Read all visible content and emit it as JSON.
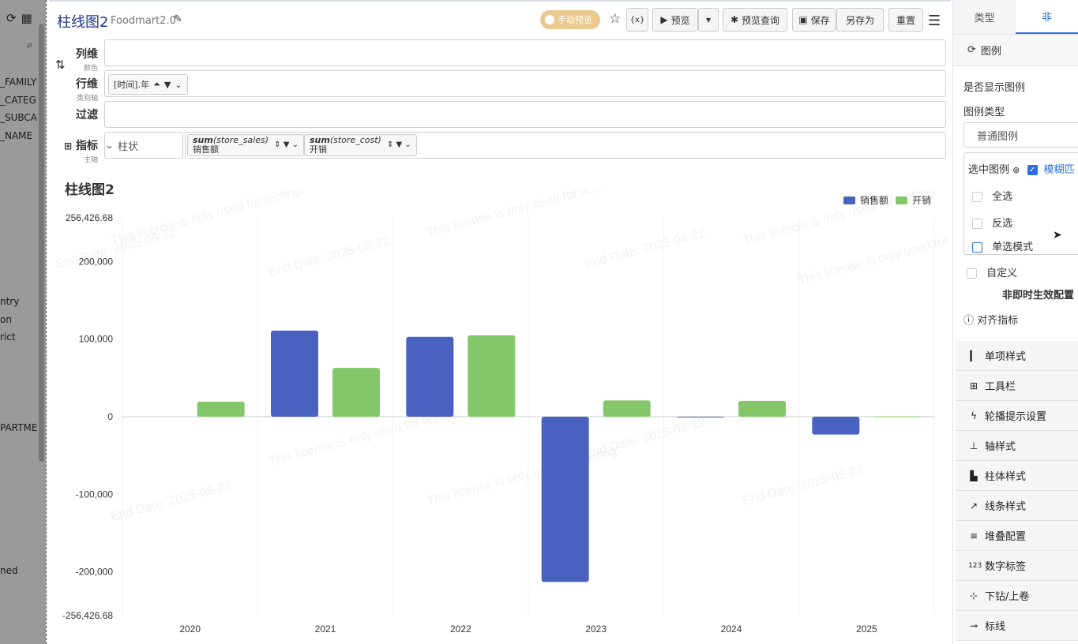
{
  "left_panel": {
    "fields": [
      "_FAMILY",
      "_CATEG",
      "_SUBCA",
      "_NAME",
      "ntry",
      "on",
      "rict",
      "PARTME",
      "ned"
    ]
  },
  "header": {
    "title": "柱线图2",
    "datasource": "Foodmart2.0",
    "manual_preview": "手动预览",
    "buttons": {
      "variable": "{x}",
      "preview": "预览",
      "preview_query": "预览查询",
      "save": "保存",
      "save_as": "另存为",
      "reset": "重置"
    }
  },
  "shelves": {
    "columns": {
      "label": "列维",
      "sub": "颜色"
    },
    "rows": {
      "label": "行维",
      "sub": "类别轴",
      "pill": "[时间].年"
    },
    "filter": {
      "label": "过滤"
    },
    "metrics": {
      "label": "指标",
      "sub": "主轴",
      "chart_type": "柱状",
      "pills": [
        {
          "func": "sum",
          "field": "(store_sales)",
          "name": "销售额"
        },
        {
          "func": "sum",
          "field": "(store_cost)",
          "name": "开销"
        }
      ]
    }
  },
  "chart_data": {
    "type": "bar",
    "title": "柱线图2",
    "categories": [
      "2020",
      "2021",
      "2022",
      "2023",
      "2024",
      "2025"
    ],
    "series": [
      {
        "name": "销售额",
        "color": "#4a62bf",
        "values": [
          0,
          111000,
          103000,
          -213000,
          -1000,
          -23000
        ]
      },
      {
        "name": "开销",
        "color": "#84c76a",
        "values": [
          19500,
          63000,
          105000,
          21000,
          20500,
          500
        ]
      }
    ],
    "y_ticks": [
      {
        "value": 256426.68,
        "label": "256,426.68"
      },
      {
        "value": 200000,
        "label": "200,000"
      },
      {
        "value": 100000,
        "label": "100,000"
      },
      {
        "value": 0,
        "label": "0"
      },
      {
        "value": -100000,
        "label": "-100,000"
      },
      {
        "value": -200000,
        "label": "-200,000"
      },
      {
        "value": -256426.68,
        "label": "-256,426.68"
      }
    ],
    "ylim": [
      -256426.68,
      256426.68
    ],
    "legend_position": "top-right",
    "watermark": [
      "This license is only used for testing!",
      "End Date: 2025-08-22"
    ]
  },
  "right_panel": {
    "tabs": [
      "类型",
      "非"
    ],
    "legend_section": "图例",
    "show_legend": "是否显示图例",
    "legend_type_label": "图例类型",
    "legend_type_value": "普通图例",
    "selected_legend": "选中图例",
    "fuzzy_match": "模糊匹",
    "select_all": "全选",
    "invert": "反选",
    "single_mode": "单选模式",
    "custom": "自定义",
    "non_instant": "非即时生效配置",
    "align_metrics": "对齐指标",
    "menu": [
      "单项样式",
      "工具栏",
      "轮播提示设置",
      "轴样式",
      "柱体样式",
      "线条样式",
      "堆叠配置",
      "数字标签",
      "下钻/上卷",
      "标线"
    ]
  }
}
